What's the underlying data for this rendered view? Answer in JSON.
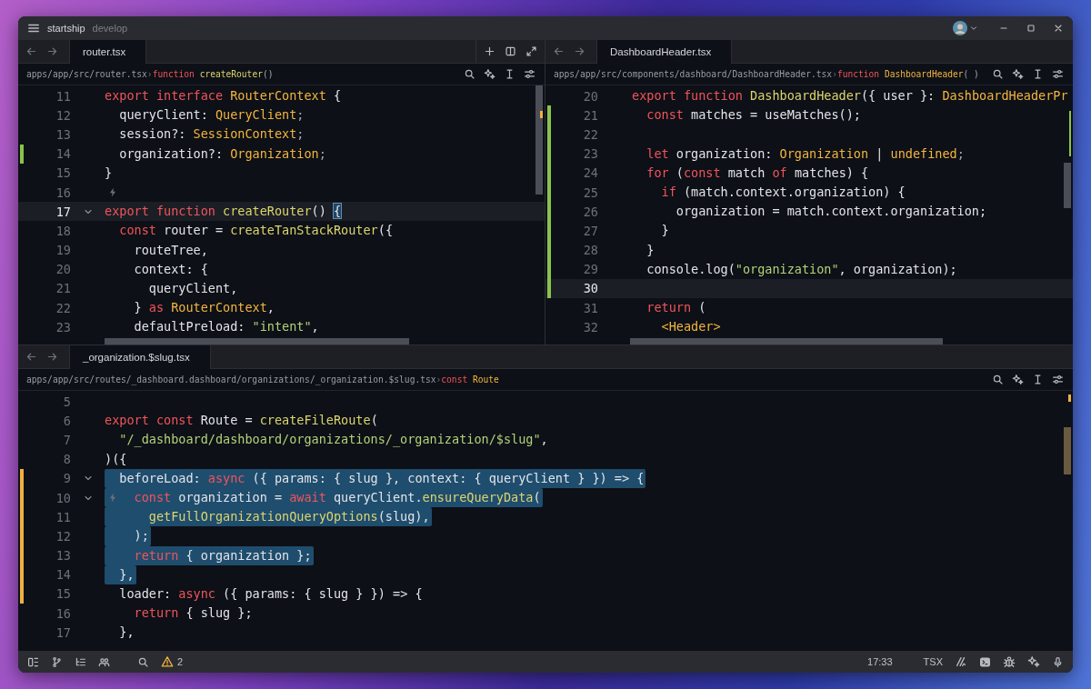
{
  "window": {
    "project": "startship",
    "branch": "develop"
  },
  "panes": [
    {
      "tab": "router.tsx",
      "breadcrumb": [
        {
          "kind": "path",
          "text": "apps/app/src/router.tsx"
        },
        {
          "kind": "sep",
          "text": "›"
        },
        {
          "kind": "kw",
          "text": "function"
        },
        {
          "kind": "fn",
          "text": " createRouter"
        },
        {
          "kind": "punct",
          "text": "()"
        }
      ],
      "lines": [
        {
          "number": "11",
          "current": false,
          "foldable": false,
          "code_action": false,
          "tokens": [
            {
              "kind": "kw",
              "text": "export interface "
            },
            {
              "kind": "type",
              "text": "RouterContext"
            },
            {
              "kind": "plain",
              "text": " {"
            }
          ]
        },
        {
          "number": "12",
          "current": false,
          "foldable": false,
          "code_action": false,
          "tokens": [
            {
              "kind": "plain",
              "text": "  queryClient: "
            },
            {
              "kind": "type",
              "text": "QueryClient"
            },
            {
              "kind": "punct",
              "text": ";"
            }
          ]
        },
        {
          "number": "13",
          "current": false,
          "foldable": false,
          "code_action": false,
          "tokens": [
            {
              "kind": "plain",
              "text": "  session?: "
            },
            {
              "kind": "type",
              "text": "SessionContext"
            },
            {
              "kind": "punct",
              "text": ";"
            }
          ]
        },
        {
          "number": "14",
          "current": false,
          "foldable": false,
          "code_action": false,
          "color": "#8bc34a",
          "tokens": [
            {
              "kind": "plain",
              "text": "  organization?: "
            },
            {
              "kind": "type",
              "text": "Organization"
            },
            {
              "kind": "punct",
              "text": ";"
            }
          ]
        },
        {
          "number": "15",
          "current": false,
          "foldable": false,
          "code_action": false,
          "tokens": [
            {
              "kind": "plain",
              "text": "}"
            }
          ]
        },
        {
          "number": "16",
          "current": false,
          "foldable": false,
          "code_action": true
        },
        {
          "number": "17",
          "current": true,
          "foldable": true,
          "code_action": false,
          "tokens": [
            {
              "kind": "kw",
              "text": "export function "
            },
            {
              "kind": "fn",
              "text": "createRouter"
            },
            {
              "kind": "plain",
              "text": "() "
            },
            {
              "kind": "match",
              "text": "{"
            }
          ]
        },
        {
          "number": "18",
          "current": false,
          "foldable": false,
          "code_action": false,
          "tokens": [
            {
              "kind": "kw",
              "text": "  const "
            },
            {
              "kind": "plain",
              "text": "router = "
            },
            {
              "kind": "fn",
              "text": "createTanStackRouter"
            },
            {
              "kind": "plain",
              "text": "({"
            }
          ]
        },
        {
          "number": "19",
          "current": false,
          "foldable": false,
          "code_action": false,
          "tokens": [
            {
              "kind": "plain",
              "text": "    routeTree,"
            }
          ]
        },
        {
          "number": "20",
          "current": false,
          "foldable": false,
          "code_action": false,
          "tokens": [
            {
              "kind": "plain",
              "text": "    context: {"
            }
          ]
        },
        {
          "number": "21",
          "current": false,
          "foldable": false,
          "code_action": false,
          "tokens": [
            {
              "kind": "plain",
              "text": "      queryClient,"
            }
          ]
        },
        {
          "number": "22",
          "current": false,
          "foldable": false,
          "code_action": false,
          "tokens": [
            {
              "kind": "plain",
              "text": "    } "
            },
            {
              "kind": "kw",
              "text": "as "
            },
            {
              "kind": "type",
              "text": "RouterContext"
            },
            {
              "kind": "plain",
              "text": ","
            }
          ]
        },
        {
          "number": "23",
          "current": false,
          "foldable": false,
          "code_action": false,
          "tokens": [
            {
              "kind": "plain",
              "text": "    defaultPreload: "
            },
            {
              "kind": "str",
              "text": "\"intent\""
            },
            {
              "kind": "plain",
              "text": ","
            }
          ]
        }
      ]
    },
    {
      "tab": "DashboardHeader.tsx",
      "breadcrumb": [
        {
          "kind": "path",
          "text": "apps/app/src/components/dashboard/DashboardHeader.tsx"
        },
        {
          "kind": "sep",
          "text": "›"
        },
        {
          "kind": "kw",
          "text": "function"
        },
        {
          "kind": "type",
          "text": " DashboardHeader"
        },
        {
          "kind": "punct",
          "text": "( )"
        }
      ],
      "lines": [
        {
          "number": "20",
          "current": false,
          "foldable": false,
          "code_action": false,
          "tokens": [
            {
              "kind": "kw",
              "text": "export function "
            },
            {
              "kind": "fn",
              "text": "DashboardHeader"
            },
            {
              "kind": "plain",
              "text": "({ user }: "
            },
            {
              "kind": "type",
              "text": "DashboardHeaderPr"
            }
          ]
        },
        {
          "number": "21",
          "current": false,
          "foldable": false,
          "code_action": false,
          "color": "#8bc34a",
          "tokens": [
            {
              "kind": "kw",
              "text": "  const "
            },
            {
              "kind": "plain",
              "text": "matches = useMatches();"
            }
          ]
        },
        {
          "number": "22",
          "current": false,
          "foldable": false,
          "code_action": false,
          "color": "#8bc34a"
        },
        {
          "number": "23",
          "current": false,
          "foldable": false,
          "code_action": false,
          "color": "#8bc34a",
          "tokens": [
            {
              "kind": "kw",
              "text": "  let "
            },
            {
              "kind": "plain",
              "text": "organization: "
            },
            {
              "kind": "type",
              "text": "Organization"
            },
            {
              "kind": "plain",
              "text": " | "
            },
            {
              "kind": "type",
              "text": "undefined"
            },
            {
              "kind": "punct",
              "text": ";"
            }
          ]
        },
        {
          "number": "24",
          "current": false,
          "foldable": false,
          "code_action": false,
          "color": "#8bc34a",
          "tokens": [
            {
              "kind": "kw",
              "text": "  for "
            },
            {
              "kind": "plain",
              "text": "("
            },
            {
              "kind": "kw",
              "text": "const "
            },
            {
              "kind": "plain",
              "text": "match "
            },
            {
              "kind": "kw",
              "text": "of "
            },
            {
              "kind": "plain",
              "text": "matches) {"
            }
          ]
        },
        {
          "number": "25",
          "current": false,
          "foldable": false,
          "code_action": false,
          "color": "#8bc34a",
          "tokens": [
            {
              "kind": "kw",
              "text": "    if "
            },
            {
              "kind": "plain",
              "text": "(match.context.organization) {"
            }
          ]
        },
        {
          "number": "26",
          "current": false,
          "foldable": false,
          "code_action": false,
          "color": "#8bc34a",
          "tokens": [
            {
              "kind": "plain",
              "text": "      organization = match.context.organization;"
            }
          ]
        },
        {
          "number": "27",
          "current": false,
          "foldable": false,
          "code_action": false,
          "color": "#8bc34a",
          "tokens": [
            {
              "kind": "plain",
              "text": "    }"
            }
          ]
        },
        {
          "number": "28",
          "current": false,
          "foldable": false,
          "code_action": false,
          "color": "#8bc34a",
          "tokens": [
            {
              "kind": "plain",
              "text": "  }"
            }
          ]
        },
        {
          "number": "29",
          "current": false,
          "foldable": false,
          "code_action": false,
          "color": "#8bc34a",
          "tokens": [
            {
              "kind": "plain",
              "text": "  console.log("
            },
            {
              "kind": "str",
              "text": "\"organization\""
            },
            {
              "kind": "plain",
              "text": ", organization);"
            }
          ]
        },
        {
          "number": "30",
          "current": true,
          "foldable": false,
          "code_action": false,
          "color": "#8bc34a"
        },
        {
          "number": "31",
          "current": false,
          "foldable": false,
          "code_action": false,
          "tokens": [
            {
              "kind": "kw",
              "text": "  return "
            },
            {
              "kind": "plain",
              "text": "("
            }
          ]
        },
        {
          "number": "32",
          "current": false,
          "foldable": false,
          "code_action": false,
          "tokens": [
            {
              "kind": "type",
              "text": "    <Header>"
            }
          ]
        }
      ]
    },
    {
      "tab": "_organization.$slug.tsx",
      "breadcrumb": [
        {
          "kind": "path",
          "text": "apps/app/src/routes/_dashboard.dashboard/organizations/_organization.$slug.tsx"
        },
        {
          "kind": "sep",
          "text": "›"
        },
        {
          "kind": "kw",
          "text": "const"
        },
        {
          "kind": "type",
          "text": " Route"
        }
      ],
      "lines": [
        {
          "number": "5",
          "selected": false,
          "foldable": false,
          "code_action": false
        },
        {
          "number": "6",
          "selected": false,
          "foldable": false,
          "code_action": false,
          "tokens": [
            {
              "kind": "kw",
              "text": "export const "
            },
            {
              "kind": "plain",
              "text": "Route = "
            },
            {
              "kind": "fn",
              "text": "createFileRoute"
            },
            {
              "kind": "plain",
              "text": "("
            }
          ]
        },
        {
          "number": "7",
          "selected": false,
          "foldable": false,
          "code_action": false,
          "tokens": [
            {
              "kind": "str",
              "text": "  \"/_dashboard/dashboard/organizations/_organization/$slug\""
            },
            {
              "kind": "plain",
              "text": ","
            }
          ]
        },
        {
          "number": "8",
          "selected": false,
          "foldable": false,
          "code_action": false,
          "tokens": [
            {
              "kind": "plain",
              "text": ")({"
            }
          ]
        },
        {
          "number": "9",
          "selected": true,
          "foldable": true,
          "code_action": false,
          "color": "#f0b040",
          "tokens": [
            {
              "kind": "plain",
              "text": "  beforeLoad: "
            },
            {
              "kind": "kw",
              "text": "async "
            },
            {
              "kind": "plain",
              "text": "({ params: { slug }, context: { queryClient } }) => {"
            }
          ]
        },
        {
          "number": "10",
          "selected": true,
          "foldable": true,
          "code_action": true,
          "color": "#f0b040",
          "tokens": [
            {
              "kind": "kw",
              "text": "    const "
            },
            {
              "kind": "plain",
              "text": "organization = "
            },
            {
              "kind": "kw",
              "text": "await "
            },
            {
              "kind": "plain",
              "text": "queryClient."
            },
            {
              "kind": "fn",
              "text": "ensureQueryData"
            },
            {
              "kind": "plain",
              "text": "("
            }
          ]
        },
        {
          "number": "11",
          "selected": true,
          "foldable": false,
          "code_action": false,
          "color": "#f0b040",
          "tokens": [
            {
              "kind": "fn",
              "text": "      getFullOrganizationQueryOptions"
            },
            {
              "kind": "plain",
              "text": "(slug),"
            }
          ]
        },
        {
          "number": "12",
          "selected": true,
          "foldable": false,
          "code_action": false,
          "color": "#f0b040",
          "tokens": [
            {
              "kind": "plain",
              "text": "    );"
            }
          ]
        },
        {
          "number": "13",
          "selected": true,
          "foldable": false,
          "code_action": false,
          "color": "#f0b040",
          "tokens": [
            {
              "kind": "kw",
              "text": "    return "
            },
            {
              "kind": "plain",
              "text": "{ organization };"
            }
          ]
        },
        {
          "number": "14",
          "selected": true,
          "foldable": false,
          "code_action": false,
          "color": "#f0b040",
          "tokens": [
            {
              "kind": "plain",
              "text": "  },"
            }
          ]
        },
        {
          "number": "15",
          "selected": false,
          "foldable": false,
          "code_action": false,
          "color": "#f0b040",
          "tokens": [
            {
              "kind": "plain",
              "text": "  loader: "
            },
            {
              "kind": "kw",
              "text": "async "
            },
            {
              "kind": "plain",
              "text": "({ params: { slug } }) => {"
            }
          ]
        },
        {
          "number": "16",
          "selected": false,
          "foldable": false,
          "code_action": false,
          "tokens": [
            {
              "kind": "kw",
              "text": "    return "
            },
            {
              "kind": "plain",
              "text": "{ slug };"
            }
          ]
        },
        {
          "number": "17",
          "selected": false,
          "foldable": false,
          "code_action": false,
          "tokens": [
            {
              "kind": "plain",
              "text": "  },"
            }
          ]
        }
      ]
    }
  ],
  "status_bar": {
    "warnings": "2",
    "cursor": "17:33",
    "language": "TSX"
  }
}
